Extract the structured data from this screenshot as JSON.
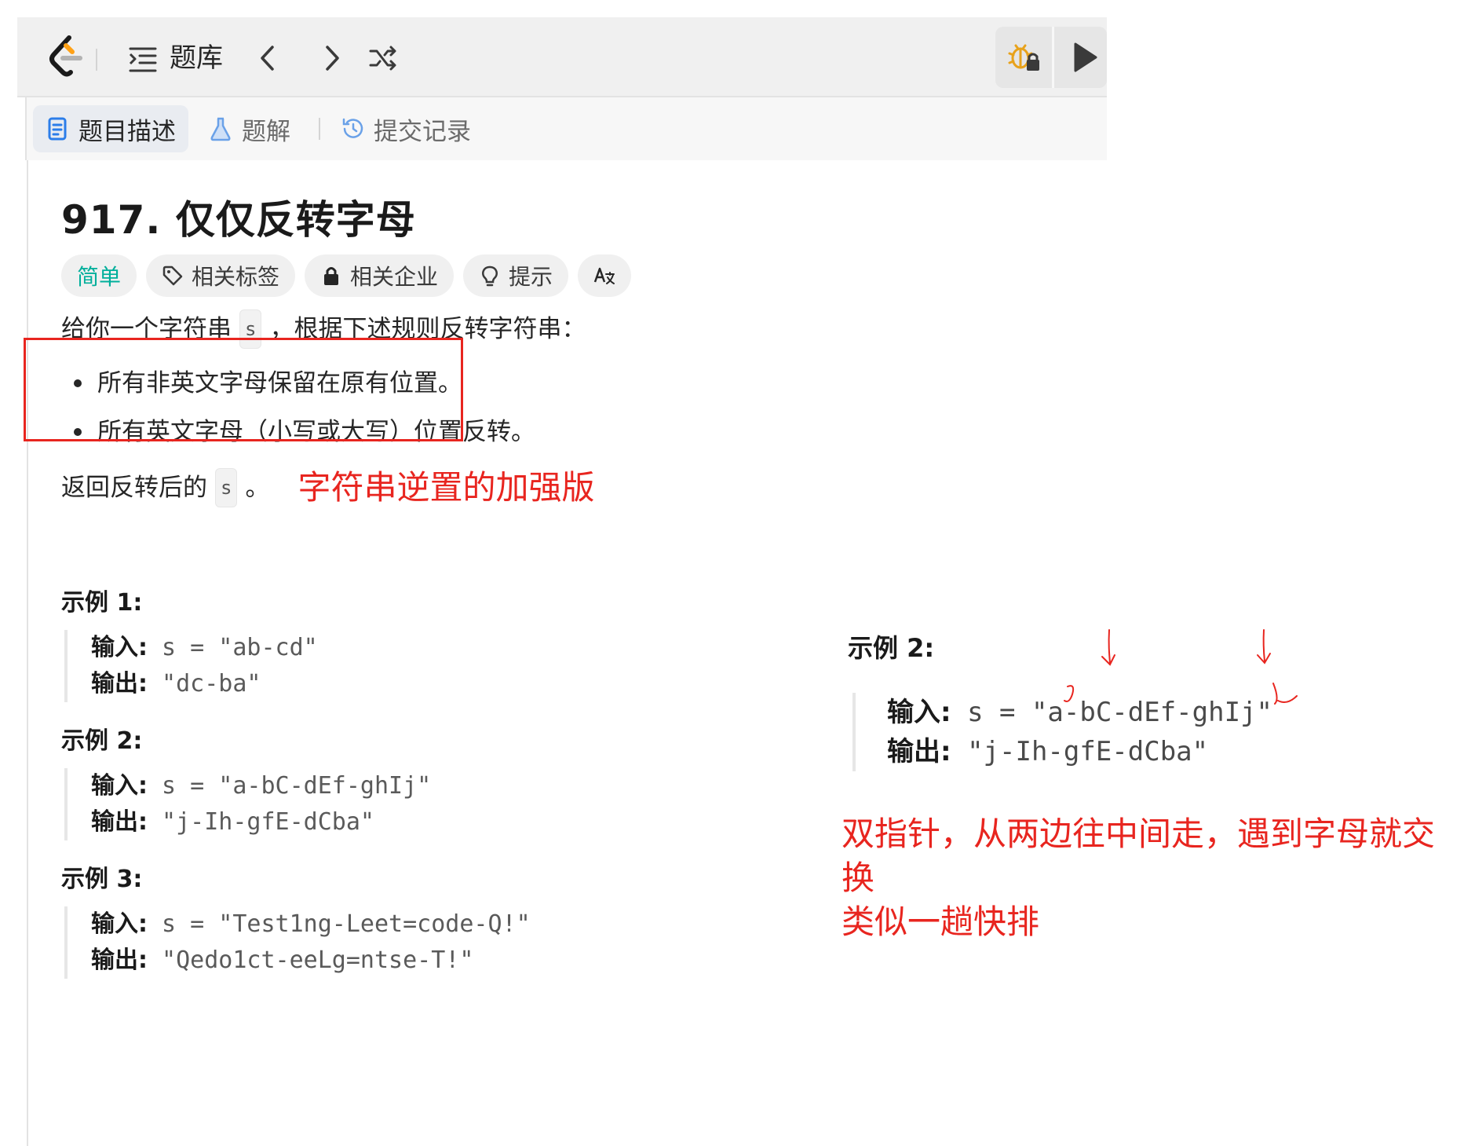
{
  "topbar": {
    "problem_bank": "题库"
  },
  "tabs": [
    {
      "label": "题目描述"
    },
    {
      "label": "题解"
    },
    {
      "label": "提交记录"
    }
  ],
  "problem": {
    "title": "917. 仅仅反转字母",
    "tags": {
      "difficulty": "简单",
      "related_tags": "相关标签",
      "related_companies": "相关企业",
      "hint": "提示"
    },
    "intro_before": "给你一个字符串",
    "intro_code": "s",
    "intro_after": "，根据下述规则反转字符串：",
    "rules": [
      "所有非英文字母保留在原有位置。",
      "所有英文字母（小写或大写）位置反转。"
    ],
    "return_before": "返回反转后的",
    "return_code": "s",
    "return_after": "。",
    "examples": [
      {
        "heading": "示例 1:",
        "input_label": "输入:",
        "input": " s = \"ab-cd\"",
        "output_label": "输出:",
        "output": " \"dc-ba\""
      },
      {
        "heading": "示例 2:",
        "input_label": "输入:",
        "input": " s = \"a-bC-dEf-ghIj\"",
        "output_label": "输出:",
        "output": " \"j-Ih-gfE-dCba\""
      },
      {
        "heading": "示例 3:",
        "input_label": "输入:",
        "input": " s = \"Test1ng-Leet=code-Q!\"",
        "output_label": "输出:",
        "output": " \"Qedo1ct-eeLg=ntse-T!\""
      }
    ]
  },
  "annotations": {
    "note_1": "字符串逆置的加强版",
    "right_example": {
      "heading": "示例 2:",
      "input_label": "输入:",
      "input": " s = \"a-bC-dEf-ghIj\"",
      "output_label": "输出:",
      "output": " \"j-Ih-gfE-dCba\""
    },
    "note_2_line1": "双指针，从两边往中间走，遇到字母就交换",
    "note_2_line2": "类似一趟快排"
  },
  "colors": {
    "accent_easy": "#00af9b",
    "annotation_red": "#e8251f"
  }
}
